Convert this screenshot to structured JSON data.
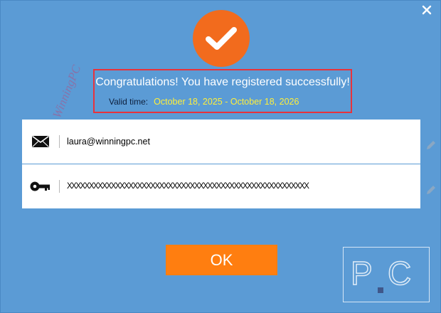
{
  "dialog": {
    "close_icon": "close-icon",
    "success_icon": "checkmark-circle-icon",
    "congrats_text": "Congratulations! You have registered successfully!",
    "valid_label": "Valid time:",
    "valid_dates": "October 18, 2025 - October 18, 2026",
    "watermark_text": "WinningPC",
    "logo_text": "P.C"
  },
  "fields": {
    "email": {
      "icon": "envelope-icon",
      "value": "laura@winningpc.net",
      "edit_icon": "pencil-icon"
    },
    "license": {
      "icon": "key-icon",
      "value": "XXXXXXXXXXXXXXXXXXXXXXXXXXXXXXXXXXXXXXXXXXXXXXXXXXXXXXX",
      "edit_icon": "pencil-icon"
    }
  },
  "actions": {
    "ok_label": "OK"
  },
  "colors": {
    "background": "#5b9bd5",
    "accent": "#f26b1d",
    "ok_button": "#ff7e10",
    "highlight_border": "#e8333c",
    "valid_dates": "#ffef3a"
  }
}
